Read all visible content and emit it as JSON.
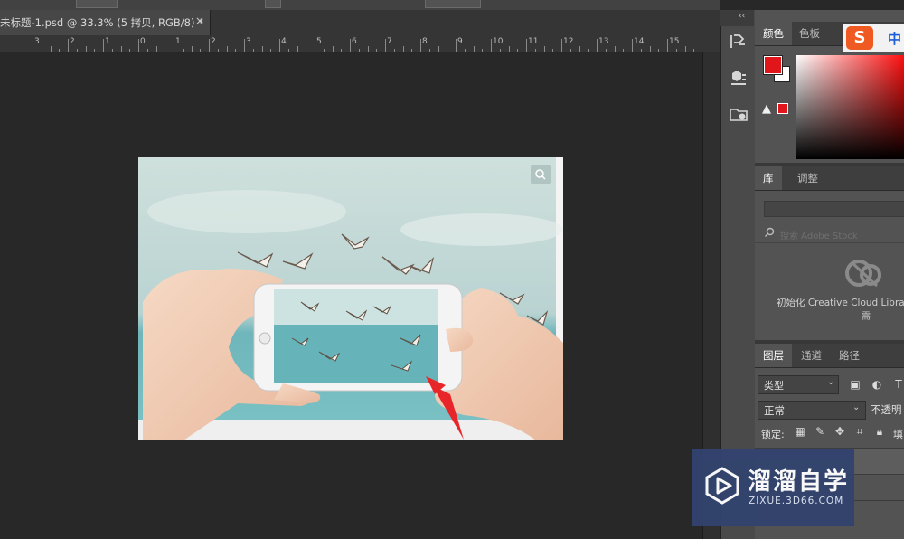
{
  "document_tab": {
    "title": "未标题-1.psd @ 33.3% (5 拷贝, RGB/8) *",
    "close": "×"
  },
  "ruler": {
    "labels": [
      "3",
      "2",
      "1",
      "0",
      "1",
      "2",
      "3",
      "4",
      "5",
      "6",
      "7",
      "8",
      "9",
      "10",
      "11",
      "12",
      "13",
      "14",
      "15"
    ]
  },
  "collapse_glyph": "‹‹",
  "color_panel": {
    "tabs": [
      "颜色",
      "色板"
    ],
    "foreground_color": "#e0161a",
    "background_color": "#ffffff",
    "gamut_warning": "▲"
  },
  "ime_badge": {
    "logo": "S",
    "mode": "中"
  },
  "library_panel": {
    "tabs": [
      "库",
      "调整"
    ],
    "search_placeholder": "搜索 Adobe Stock",
    "init_text": "初始化 Creative Cloud Libraries",
    "init_text_cont": "需"
  },
  "layers_panel": {
    "tabs": [
      "图层",
      "通道",
      "路径"
    ],
    "filter_kind": "类型",
    "blend_mode": "正常",
    "opacity_label": "不透明",
    "lock_label": "锁定:",
    "fill_label": "填"
  },
  "watermark": {
    "brand": "溜溜自学",
    "url": "ZIXUE.3D66.COM"
  },
  "colors": {
    "panel_bg": "#535353",
    "workspace": "#282828",
    "accent_red": "#e0161a",
    "watermark_bg": "#32436e"
  }
}
